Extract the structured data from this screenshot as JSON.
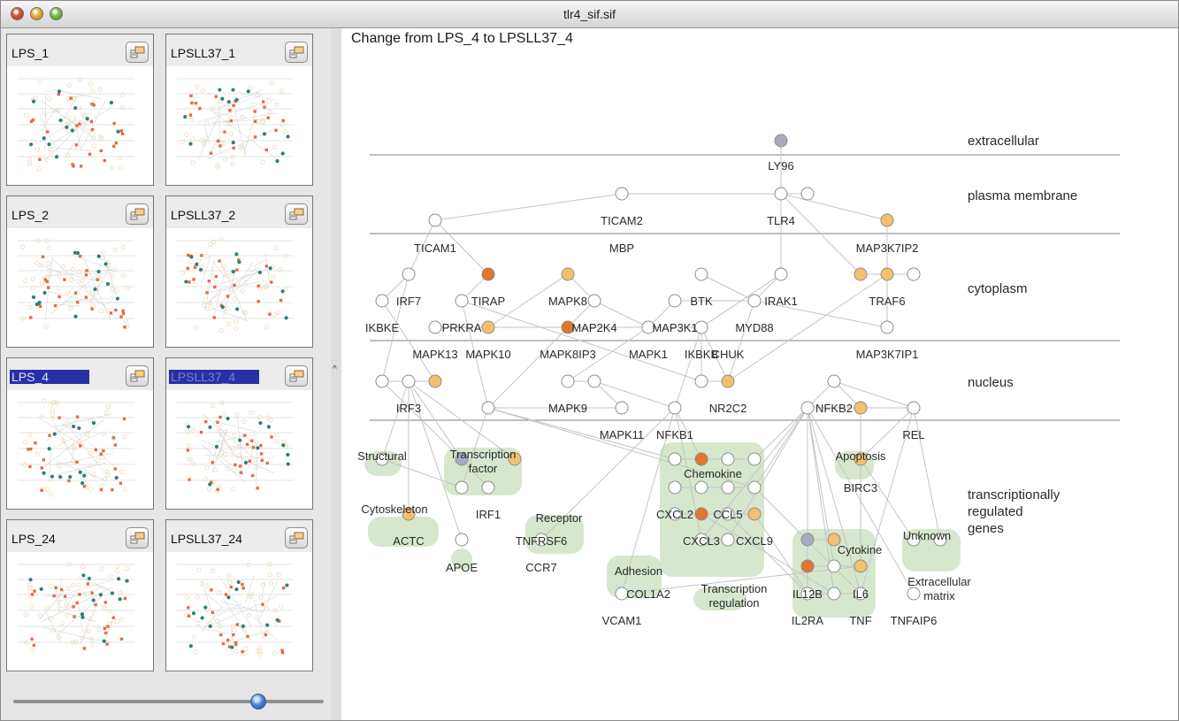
{
  "window": {
    "title": "tlr4_sif.sif"
  },
  "sidebar": {
    "thumbnails": [
      {
        "name": "LPS_1",
        "selected": false
      },
      {
        "name": "LPSLL37_1",
        "selected": false
      },
      {
        "name": "LPS_2",
        "selected": false
      },
      {
        "name": "LPSLL37_2",
        "selected": false
      },
      {
        "name": "LPS_4",
        "selected": true
      },
      {
        "name": "LPSLL37_4",
        "selected": true
      },
      {
        "name": "LPS_24",
        "selected": false
      },
      {
        "name": "LPSLL37_24",
        "selected": false
      }
    ],
    "slider_fraction": 0.79
  },
  "main": {
    "title": "Change from LPS_4 to LPSLL37_4",
    "layers": [
      "extracellular",
      "plasma membrane",
      "cytoplasm",
      "nucleus",
      "transcriptionally\nregulated\ngenes"
    ],
    "gene_labels": [
      "LY96",
      "TICAM2",
      "TLR4",
      "TICAM1",
      "MBP",
      "MAP3K7IP2",
      "IRF7",
      "TIRAP",
      "MAPK8",
      "BTK",
      "IRAK1",
      "TRAF6",
      "IKBKE",
      "PRKRA",
      "MAP2K4",
      "MAP3K1",
      "MYD88",
      "MAPK13",
      "MAPK10",
      "MAPK8IP3",
      "MAPK1",
      "IKBKB",
      "CHUK",
      "MAP3K7IP1",
      "IRF3",
      "MAPK9",
      "NR2C2",
      "NFKB2",
      "MAPK11",
      "NFKB1",
      "REL",
      "BIRC3",
      "IRF1",
      "CXCL2",
      "CCL5",
      "CXCL3",
      "CXCL9",
      "ACTC",
      "APOE",
      "CCR7",
      "TNFRSF6",
      "COL1A2",
      "VCAM1",
      "IL12B",
      "IL6",
      "IL2RA",
      "TNF",
      "TNFAIP6"
    ],
    "categories": [
      "Structural",
      "Transcription\nfactor",
      "Cytoskeleton",
      "Receptor",
      "Chemokine",
      "Apoptosis",
      "Adhesion",
      "Transcription\nregulation",
      "Cytokine",
      "Unknown",
      "Extracellular\nmatrix"
    ],
    "colors": {
      "node_neutral": "#ffffff",
      "node_light_orange": "#f6bf6e",
      "node_dark_orange": "#e2762a",
      "node_gray": "#a9a9c4",
      "category_background": "#cfe3c6",
      "selection_blue": "#2730a4"
    }
  }
}
